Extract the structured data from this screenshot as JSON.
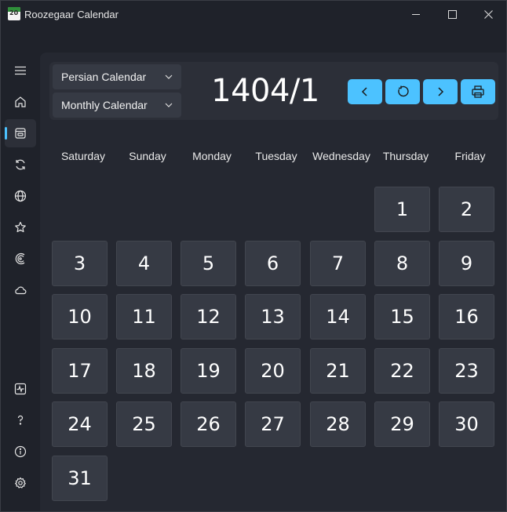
{
  "window": {
    "title": "Roozegaar Calendar",
    "app_icon_text": "20"
  },
  "sidebar": {
    "items": [
      {
        "name": "menu",
        "icon": "hamburger-icon",
        "active": false
      },
      {
        "name": "home",
        "icon": "home-icon",
        "active": false
      },
      {
        "name": "calendar",
        "icon": "calendar-icon",
        "active": true
      },
      {
        "name": "convert",
        "icon": "sync-icon",
        "active": false
      },
      {
        "name": "world",
        "icon": "globe-icon",
        "active": false
      },
      {
        "name": "favorites",
        "icon": "star-icon",
        "active": false
      },
      {
        "name": "moon",
        "icon": "moon-phase-icon",
        "active": false
      },
      {
        "name": "weather",
        "icon": "cloud-icon",
        "active": false
      },
      {
        "name": "activity",
        "icon": "pulse-icon",
        "active": false
      },
      {
        "name": "help",
        "icon": "question-icon",
        "active": false
      },
      {
        "name": "about",
        "icon": "info-icon",
        "active": false
      },
      {
        "name": "settings",
        "icon": "gear-icon",
        "active": false
      }
    ]
  },
  "header": {
    "calendar_type": "Persian Calendar",
    "view_type": "Monthly Calendar",
    "current_month": "1404/1"
  },
  "weekdays": [
    "Saturday",
    "Sunday",
    "Monday",
    "Tuesday",
    "Wednesday",
    "Thursday",
    "Friday"
  ],
  "days": [
    "1",
    "2",
    "3",
    "4",
    "5",
    "6",
    "7",
    "8",
    "9",
    "10",
    "11",
    "12",
    "13",
    "14",
    "15",
    "16",
    "17",
    "18",
    "19",
    "20",
    "21",
    "22",
    "23",
    "24",
    "25",
    "26",
    "27",
    "28",
    "29",
    "30",
    "31"
  ],
  "first_day_column": 5,
  "colors": {
    "accent": "#4cc2ff",
    "background": "#1f222a",
    "panel": "#252831",
    "cell": "#363a44"
  }
}
